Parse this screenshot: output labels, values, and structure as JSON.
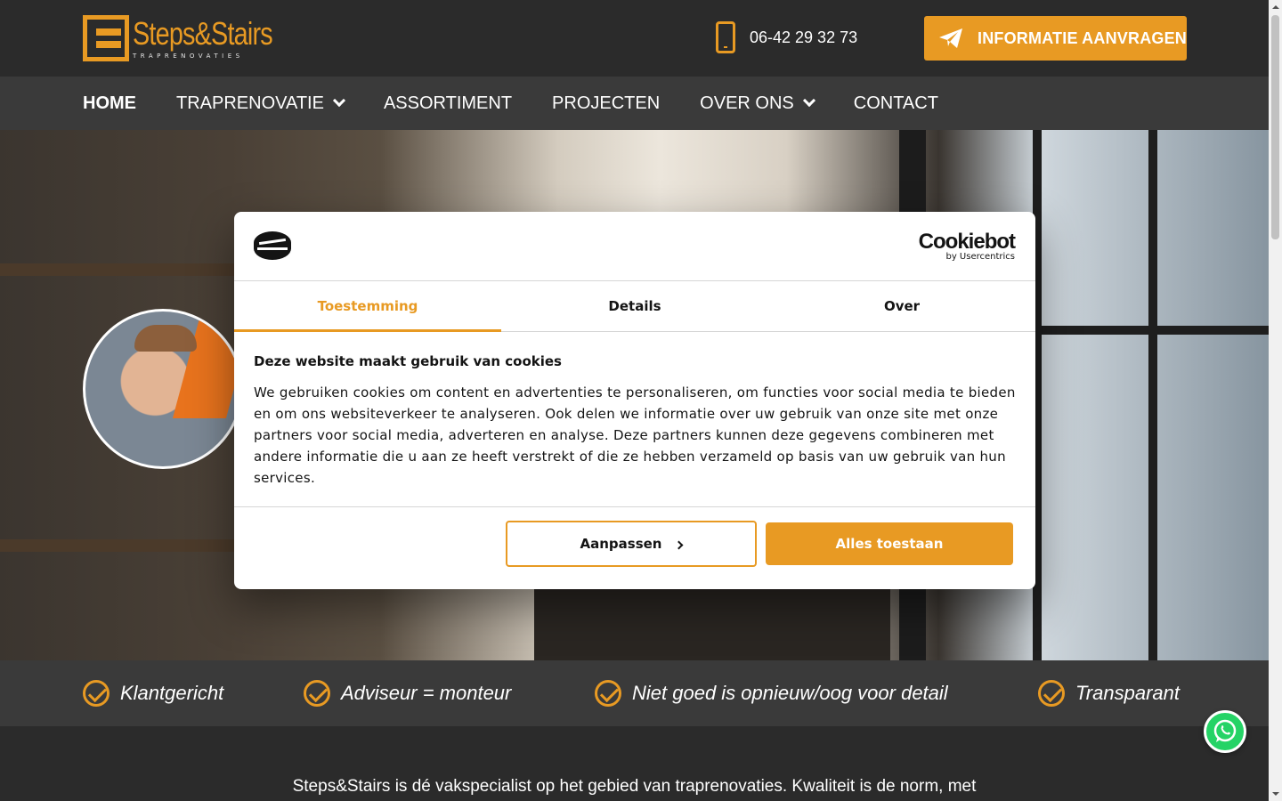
{
  "header": {
    "logo_name": "Steps&Stairs",
    "logo_sub": "TRAPRENOVATIES",
    "phone": "06-42 29 32 73",
    "cta_label": "INFORMATIE AANVRAGEN"
  },
  "nav": {
    "items": [
      {
        "label": "HOME"
      },
      {
        "label": "TRAPRENOVATIE"
      },
      {
        "label": "ASSORTIMENT"
      },
      {
        "label": "PROJECTEN"
      },
      {
        "label": "OVER ONS"
      },
      {
        "label": "CONTACT"
      }
    ]
  },
  "values": [
    {
      "label": "Klantgericht"
    },
    {
      "label": "Adviseur = monteur"
    },
    {
      "label": "Niet goed is opnieuw/oog voor detail"
    },
    {
      "label": "Transparant"
    }
  ],
  "intro": {
    "text": "Steps&Stairs is dé vakspecialist op het gebied van traprenovaties. Kwaliteit is de norm, met"
  },
  "cookie": {
    "brand_name": "Cookiebot",
    "brand_by": "by Usercentrics",
    "tabs": [
      {
        "label": "Toestemming"
      },
      {
        "label": "Details"
      },
      {
        "label": "Over"
      }
    ],
    "title": "Deze website maakt gebruik van cookies",
    "body": "We gebruiken cookies om content en advertenties te personaliseren, om functies voor social media te bieden en om ons websiteverkeer te analyseren. Ook delen we informatie over uw gebruik van onze site met onze partners voor social media, adverteren en analyse. Deze partners kunnen deze gegevens combineren met andere informatie die u aan ze heeft verstrekt of die ze hebben verzameld op basis van uw gebruik van hun services.",
    "customize_label": "Aanpassen",
    "allow_label": "Alles toestaan"
  },
  "colors": {
    "accent": "#e89a23",
    "header_bg": "#2b2b2b",
    "nav_bg": "#3a3a3a",
    "whatsapp": "#25d366"
  }
}
